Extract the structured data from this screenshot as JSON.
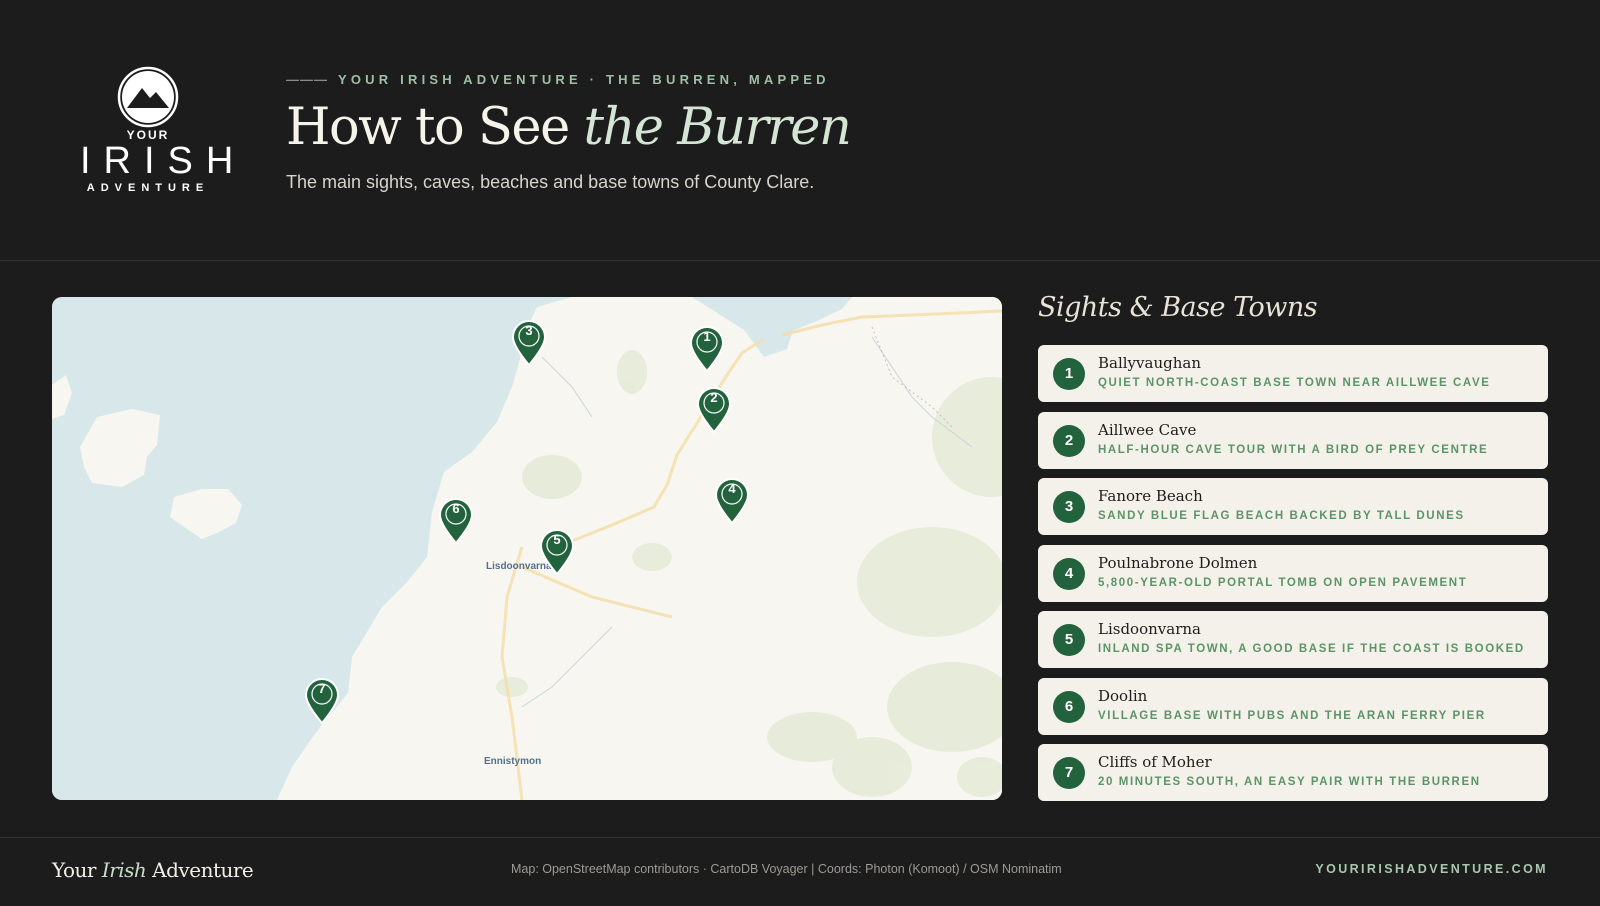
{
  "header": {
    "logo": {
      "line1": "YOUR",
      "line2": "IRISH",
      "line3": "ADVENTURE"
    },
    "eyebrow_dash": "———",
    "eyebrow": "YOUR IRISH ADVENTURE · THE BURREN, MAPPED",
    "title_plain": "How to See ",
    "title_italic": "the Burren",
    "subtitle": "The main sights, caves, beaches and base towns of County Clare."
  },
  "map": {
    "places": [
      "Lisdoonvarna",
      "Ennistymon"
    ],
    "markers": [
      "1",
      "2",
      "3",
      "4",
      "5",
      "6",
      "7"
    ]
  },
  "panel": {
    "title": "Sights & Base Towns",
    "items": [
      {
        "num": "1",
        "name": "Ballyvaughan",
        "desc": "Quiet north-coast base town near Aillwee Cave"
      },
      {
        "num": "2",
        "name": "Aillwee Cave",
        "desc": "Half-hour cave tour with a bird of prey centre"
      },
      {
        "num": "3",
        "name": "Fanore Beach",
        "desc": "Sandy Blue Flag beach backed by tall dunes"
      },
      {
        "num": "4",
        "name": "Poulnabrone Dolmen",
        "desc": "5,800-year-old portal tomb on open pavement"
      },
      {
        "num": "5",
        "name": "Lisdoonvarna",
        "desc": "Inland spa town, a good base if the coast is booked"
      },
      {
        "num": "6",
        "name": "Doolin",
        "desc": "Village base with pubs and the Aran ferry pier"
      },
      {
        "num": "7",
        "name": "Cliffs of Moher",
        "desc": "20 minutes south, an easy pair with the Burren"
      }
    ]
  },
  "footer": {
    "brand_a": "Your ",
    "brand_b": "Irish",
    "brand_c": " Adventure",
    "credit": "Map: OpenStreetMap contributors · CartoDB Voyager | Coords: Photon (Komoot) / OSM Nominatim",
    "site": "YOURIRISHADVENTURE.COM"
  },
  "colors": {
    "background": "#1c1c1c",
    "accent": "#22623c",
    "sea": "#d7e7ea",
    "land": "#f8f6f1"
  }
}
